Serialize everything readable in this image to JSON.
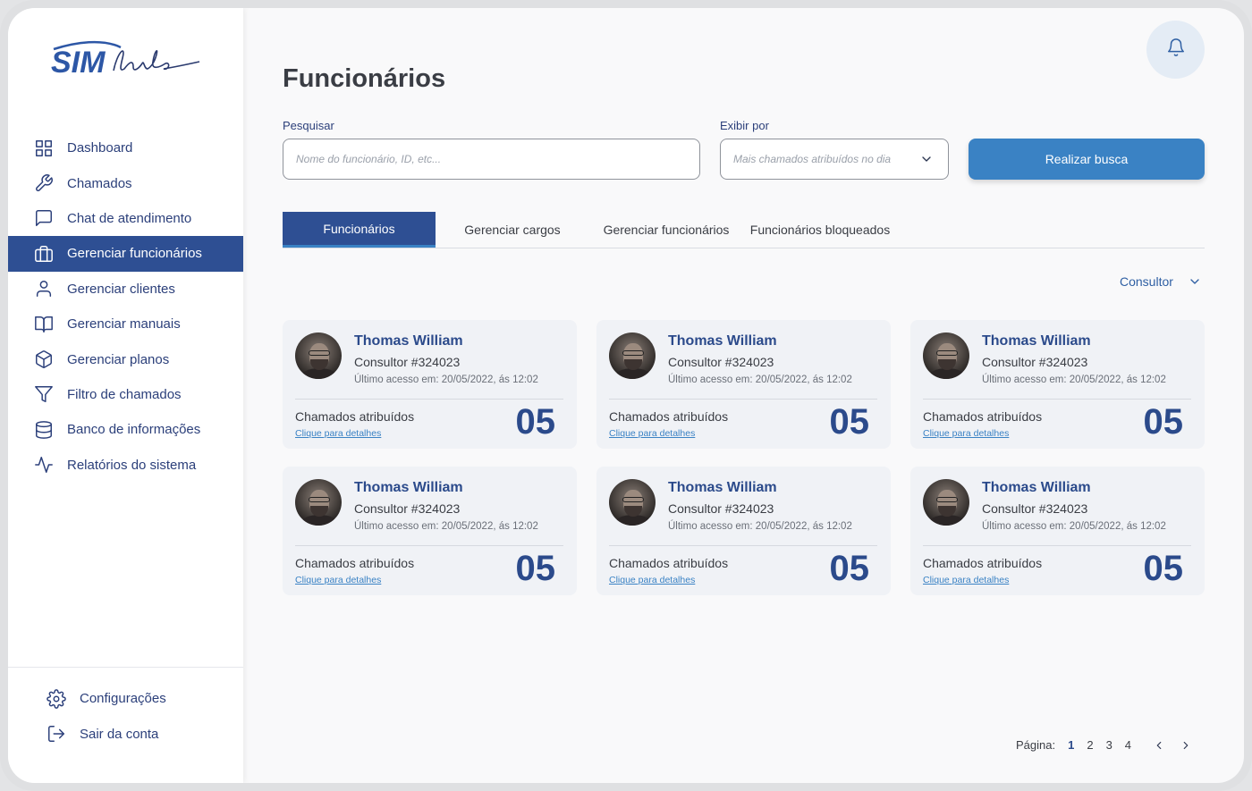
{
  "brand": {
    "logo_text": "SIMclub"
  },
  "sidebar": {
    "items": [
      {
        "label": "Dashboard",
        "icon": "grid-icon"
      },
      {
        "label": "Chamados",
        "icon": "wrench-icon"
      },
      {
        "label": "Chat de atendimento",
        "icon": "chat-icon"
      },
      {
        "label": "Gerenciar funcionários",
        "icon": "briefcase-icon",
        "active": true
      },
      {
        "label": "Gerenciar clientes",
        "icon": "user-icon"
      },
      {
        "label": "Gerenciar manuais",
        "icon": "book-icon"
      },
      {
        "label": "Gerenciar planos",
        "icon": "box-icon"
      },
      {
        "label": "Filtro de chamados",
        "icon": "filter-icon"
      },
      {
        "label": "Banco de informações",
        "icon": "database-icon"
      },
      {
        "label": "Relatórios do sistema",
        "icon": "activity-icon"
      }
    ],
    "bottom": [
      {
        "label": "Configurações",
        "icon": "gear-icon"
      },
      {
        "label": "Sair da conta",
        "icon": "logout-icon"
      }
    ]
  },
  "header": {
    "title": "Funcionários"
  },
  "search": {
    "label": "Pesquisar",
    "placeholder": "Nome do funcionário, ID, etc...",
    "value": ""
  },
  "display_by": {
    "label": "Exibir por",
    "selected": "Mais chamados atribuídos no dia"
  },
  "search_button": "Realizar busca",
  "tabs": [
    {
      "label": "Funcionários",
      "active": true
    },
    {
      "label": "Gerenciar cargos"
    },
    {
      "label": "Gerenciar funcionários"
    },
    {
      "label": "Funcionários bloqueados"
    }
  ],
  "role_filter": "Consultor",
  "cards": [
    {
      "name": "Thomas William",
      "role": "Consultor #324023",
      "last_access": "Último acesso em: 20/05/2022, ás 12:02",
      "assigned_label": "Chamados atribuídos",
      "details_link": "Clique para detalhes",
      "count": "05"
    },
    {
      "name": "Thomas William",
      "role": "Consultor #324023",
      "last_access": "Último acesso em: 20/05/2022, ás 12:02",
      "assigned_label": "Chamados atribuídos",
      "details_link": "Clique para detalhes",
      "count": "05"
    },
    {
      "name": "Thomas William",
      "role": "Consultor #324023",
      "last_access": "Último acesso em: 20/05/2022, ás 12:02",
      "assigned_label": "Chamados atribuídos",
      "details_link": "Clique para detalhes",
      "count": "05"
    },
    {
      "name": "Thomas William",
      "role": "Consultor #324023",
      "last_access": "Último acesso em: 20/05/2022, ás 12:02",
      "assigned_label": "Chamados atribuídos",
      "details_link": "Clique para detalhes",
      "count": "05"
    },
    {
      "name": "Thomas William",
      "role": "Consultor #324023",
      "last_access": "Último acesso em: 20/05/2022, ás 12:02",
      "assigned_label": "Chamados atribuídos",
      "details_link": "Clique para detalhes",
      "count": "05"
    },
    {
      "name": "Thomas William",
      "role": "Consultor #324023",
      "last_access": "Último acesso em: 20/05/2022, ás 12:02",
      "assigned_label": "Chamados atribuídos",
      "details_link": "Clique para detalhes",
      "count": "05"
    }
  ],
  "pagination": {
    "label": "Página:",
    "pages": [
      "1",
      "2",
      "3",
      "4"
    ],
    "current": "1"
  },
  "colors": {
    "primary": "#2e4f93",
    "accent": "#3a82c4",
    "text_dark": "#3a3d44"
  }
}
